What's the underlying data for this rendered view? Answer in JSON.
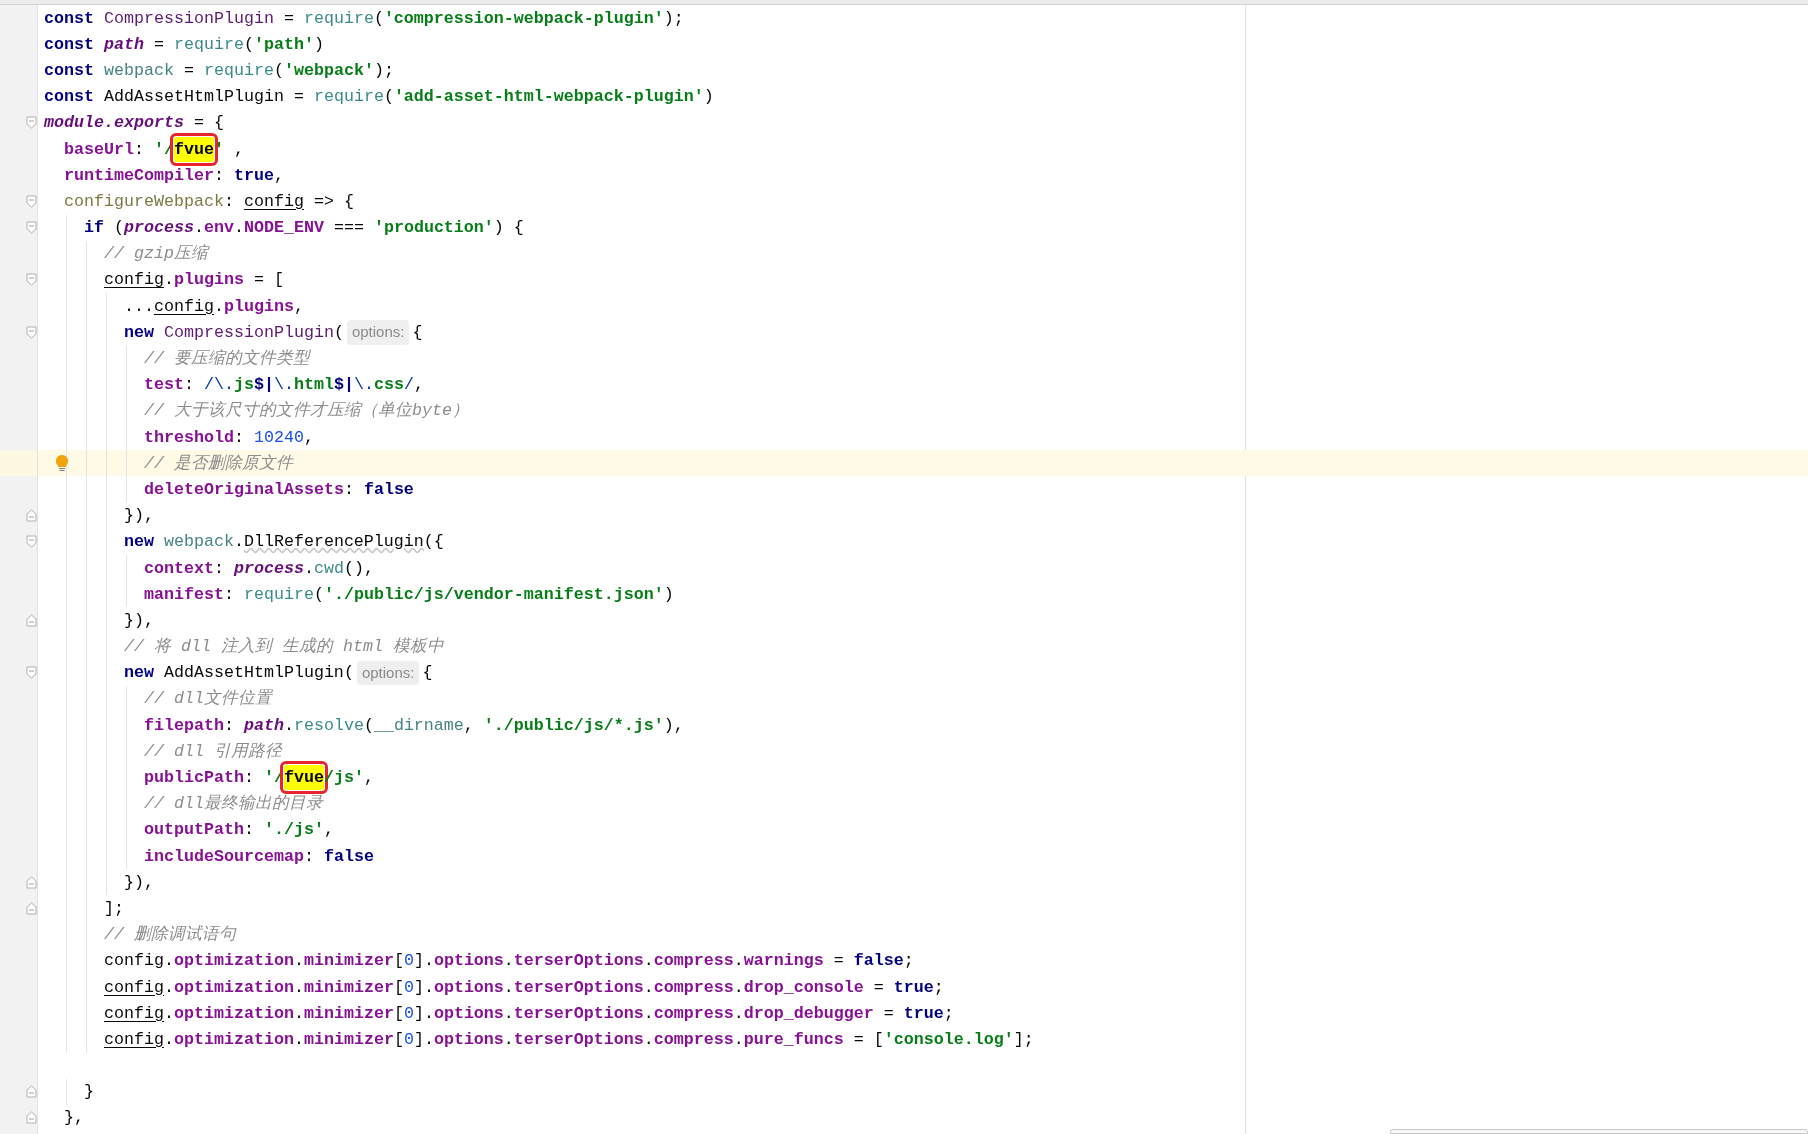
{
  "editor": {
    "lines": [
      {
        "kind": "plain",
        "current": false,
        "tokens": [
          {
            "text": "const ",
            "kind": "kw"
          },
          {
            "text": "CompressionPlugin",
            "kind": "cls"
          },
          {
            "text": " = ",
            "kind": "plain"
          },
          {
            "text": "require",
            "kind": "fn"
          },
          {
            "text": "(",
            "kind": "plain"
          },
          {
            "text": "'compression-webpack-plugin'",
            "kind": "str"
          },
          {
            "text": ");",
            "kind": "plain"
          }
        ]
      },
      {
        "kind": "plain",
        "current": false,
        "tokens": [
          {
            "text": "const ",
            "kind": "kw"
          },
          {
            "text": "path",
            "kind": "ital"
          },
          {
            "text": " = ",
            "kind": "plain"
          },
          {
            "text": "require",
            "kind": "fn"
          },
          {
            "text": "(",
            "kind": "plain"
          },
          {
            "text": "'path'",
            "kind": "str"
          },
          {
            "text": ")",
            "kind": "plain"
          }
        ]
      },
      {
        "kind": "plain",
        "current": false,
        "tokens": [
          {
            "text": "const ",
            "kind": "kw"
          },
          {
            "text": "webpack",
            "kind": "var"
          },
          {
            "text": " = ",
            "kind": "plain"
          },
          {
            "text": "require",
            "kind": "fn"
          },
          {
            "text": "(",
            "kind": "plain"
          },
          {
            "text": "'webpack'",
            "kind": "str"
          },
          {
            "text": ");",
            "kind": "plain"
          }
        ]
      },
      {
        "kind": "plain",
        "current": false,
        "tokens": [
          {
            "text": "const ",
            "kind": "kw"
          },
          {
            "text": "AddAssetHtmlPlugin",
            "kind": "plain"
          },
          {
            "text": " = ",
            "kind": "plain"
          },
          {
            "text": "require",
            "kind": "fn"
          },
          {
            "text": "(",
            "kind": "plain"
          },
          {
            "text": "'add-asset-html-webpack-plugin'",
            "kind": "str"
          },
          {
            "text": ")",
            "kind": "plain"
          }
        ]
      },
      {
        "kind": "opener",
        "current": false,
        "tokens": [
          {
            "text": "module.exports",
            "kind": "ital"
          },
          {
            "text": " = {",
            "kind": "plain"
          }
        ]
      },
      {
        "kind": "plain",
        "current": false,
        "tokens": [
          {
            "text": "  baseUrl",
            "kind": "prop"
          },
          {
            "text": ": ",
            "kind": "plain"
          },
          {
            "text": "'/",
            "kind": "str"
          },
          {
            "text": "fvue",
            "kind": "found"
          },
          {
            "text": "'",
            "kind": "str"
          },
          {
            "text": " ,",
            "kind": "plain"
          }
        ]
      },
      {
        "kind": "plain",
        "current": false,
        "tokens": [
          {
            "text": "  runtimeCompiler",
            "kind": "prop"
          },
          {
            "text": ": ",
            "kind": "plain"
          },
          {
            "text": "true",
            "kind": "kw"
          },
          {
            "text": ",",
            "kind": "plain"
          }
        ]
      },
      {
        "kind": "opener",
        "current": false,
        "tokens": [
          {
            "text": "  configureWebpack",
            "kind": "meth"
          },
          {
            "text": ": ",
            "kind": "plain"
          },
          {
            "text": "config",
            "kind": "param"
          },
          {
            "text": " => {",
            "kind": "plain"
          }
        ]
      },
      {
        "kind": "opener",
        "current": false,
        "tokens": [
          {
            "text": "    if",
            "kind": "kw"
          },
          {
            "text": " (",
            "kind": "plain"
          },
          {
            "text": "process",
            "kind": "ital"
          },
          {
            "text": ".",
            "kind": "plain"
          },
          {
            "text": "env",
            "kind": "prop"
          },
          {
            "text": ".",
            "kind": "plain"
          },
          {
            "text": "NODE_ENV",
            "kind": "prop"
          },
          {
            "text": " === ",
            "kind": "plain"
          },
          {
            "text": "'production'",
            "kind": "str"
          },
          {
            "text": ") {",
            "kind": "plain"
          }
        ]
      },
      {
        "kind": "plain",
        "current": false,
        "tokens": [
          {
            "text": "      // gzip压缩",
            "kind": "cm"
          }
        ]
      },
      {
        "kind": "opener",
        "current": false,
        "tokens": [
          {
            "text": "      config",
            "kind": "param"
          },
          {
            "text": ".",
            "kind": "plain"
          },
          {
            "text": "plugins",
            "kind": "prop"
          },
          {
            "text": " = [",
            "kind": "plain"
          }
        ]
      },
      {
        "kind": "plain",
        "current": false,
        "tokens": [
          {
            "text": "        ...",
            "kind": "plain"
          },
          {
            "text": "config",
            "kind": "param"
          },
          {
            "text": ".",
            "kind": "plain"
          },
          {
            "text": "plugins",
            "kind": "prop"
          },
          {
            "text": ",",
            "kind": "plain"
          }
        ]
      },
      {
        "kind": "opener",
        "current": false,
        "tokens": [
          {
            "text": "        new ",
            "kind": "kw"
          },
          {
            "text": "CompressionPlugin",
            "kind": "cls"
          },
          {
            "text": "(",
            "kind": "plain"
          },
          {
            "text": "options:",
            "kind": "hint"
          },
          {
            "text": "{",
            "kind": "plain"
          }
        ]
      },
      {
        "kind": "plain",
        "current": false,
        "tokens": [
          {
            "text": "          // 要压缩的文件类型",
            "kind": "cm"
          }
        ]
      },
      {
        "kind": "plain",
        "current": false,
        "tokens": [
          {
            "text": "          test",
            "kind": "prop"
          },
          {
            "text": ": ",
            "kind": "plain"
          },
          {
            "text": "/\\.",
            "kind": "rx"
          },
          {
            "text": "js",
            "kind": "str"
          },
          {
            "text": "$|",
            "kind": "kw"
          },
          {
            "text": "\\.",
            "kind": "rx"
          },
          {
            "text": "html",
            "kind": "str"
          },
          {
            "text": "$|",
            "kind": "kw"
          },
          {
            "text": "\\.",
            "kind": "rx"
          },
          {
            "text": "css",
            "kind": "str"
          },
          {
            "text": "/",
            "kind": "rx"
          },
          {
            "text": ",",
            "kind": "plain"
          }
        ]
      },
      {
        "kind": "plain",
        "current": false,
        "tokens": [
          {
            "text": "          // 大于该尺寸的文件才压缩（单位byte）",
            "kind": "cm"
          }
        ]
      },
      {
        "kind": "plain",
        "current": false,
        "tokens": [
          {
            "text": "          threshold",
            "kind": "prop"
          },
          {
            "text": ": ",
            "kind": "plain"
          },
          {
            "text": "10240",
            "kind": "num"
          },
          {
            "text": ",",
            "kind": "plain"
          }
        ]
      },
      {
        "kind": "plain",
        "current": true,
        "tokens": [
          {
            "text": "          // 是否删除原文件",
            "kind": "cm"
          }
        ]
      },
      {
        "kind": "plain",
        "current": false,
        "tokens": [
          {
            "text": "          deleteOriginalAssets",
            "kind": "prop"
          },
          {
            "text": ": ",
            "kind": "plain"
          },
          {
            "text": "false",
            "kind": "kw"
          }
        ]
      },
      {
        "kind": "closer",
        "current": false,
        "tokens": [
          {
            "text": "        }),",
            "kind": "plain"
          }
        ]
      },
      {
        "kind": "opener",
        "current": false,
        "tokens": [
          {
            "text": "        new ",
            "kind": "kw"
          },
          {
            "text": "webpack",
            "kind": "var"
          },
          {
            "text": ".",
            "kind": "plain"
          },
          {
            "text": "DllReferencePlugin",
            "kind": "warn"
          },
          {
            "text": "({",
            "kind": "plain"
          }
        ]
      },
      {
        "kind": "plain",
        "current": false,
        "tokens": [
          {
            "text": "          context",
            "kind": "prop"
          },
          {
            "text": ": ",
            "kind": "plain"
          },
          {
            "text": "process",
            "kind": "ital"
          },
          {
            "text": ".",
            "kind": "plain"
          },
          {
            "text": "cwd",
            "kind": "fn"
          },
          {
            "text": "(),",
            "kind": "plain"
          }
        ]
      },
      {
        "kind": "plain",
        "current": false,
        "tokens": [
          {
            "text": "          manifest",
            "kind": "prop"
          },
          {
            "text": ": ",
            "kind": "plain"
          },
          {
            "text": "require",
            "kind": "fn"
          },
          {
            "text": "(",
            "kind": "plain"
          },
          {
            "text": "'./public/js/vendor-manifest.json'",
            "kind": "str"
          },
          {
            "text": ")",
            "kind": "plain"
          }
        ]
      },
      {
        "kind": "closer",
        "current": false,
        "tokens": [
          {
            "text": "        }),",
            "kind": "plain"
          }
        ]
      },
      {
        "kind": "plain",
        "current": false,
        "tokens": [
          {
            "text": "        // 将 dll 注入到 生成的 html 模板中",
            "kind": "cm"
          }
        ]
      },
      {
        "kind": "opener",
        "current": false,
        "tokens": [
          {
            "text": "        new ",
            "kind": "kw"
          },
          {
            "text": "AddAssetHtmlPlugin",
            "kind": "plain"
          },
          {
            "text": "(",
            "kind": "plain"
          },
          {
            "text": "options:",
            "kind": "hint"
          },
          {
            "text": "{",
            "kind": "plain"
          }
        ]
      },
      {
        "kind": "plain",
        "current": false,
        "tokens": [
          {
            "text": "          // dll文件位置",
            "kind": "cm"
          }
        ]
      },
      {
        "kind": "plain",
        "current": false,
        "tokens": [
          {
            "text": "          filepath",
            "kind": "prop"
          },
          {
            "text": ": ",
            "kind": "plain"
          },
          {
            "text": "path",
            "kind": "ital"
          },
          {
            "text": ".",
            "kind": "plain"
          },
          {
            "text": "resolve",
            "kind": "fn"
          },
          {
            "text": "(",
            "kind": "plain"
          },
          {
            "text": "__dirname",
            "kind": "var"
          },
          {
            "text": ", ",
            "kind": "plain"
          },
          {
            "text": "'./public/js/*.js'",
            "kind": "str"
          },
          {
            "text": "),",
            "kind": "plain"
          }
        ]
      },
      {
        "kind": "plain",
        "current": false,
        "tokens": [
          {
            "text": "          // dll 引用路径",
            "kind": "cm"
          }
        ]
      },
      {
        "kind": "plain",
        "current": false,
        "tokens": [
          {
            "text": "          publicPath",
            "kind": "prop"
          },
          {
            "text": ": ",
            "kind": "plain"
          },
          {
            "text": "'/",
            "kind": "str"
          },
          {
            "text": "fvue",
            "kind": "found"
          },
          {
            "text": "/js'",
            "kind": "str"
          },
          {
            "text": ",",
            "kind": "plain"
          }
        ]
      },
      {
        "kind": "plain",
        "current": false,
        "tokens": [
          {
            "text": "          // dll最终输出的目录",
            "kind": "cm"
          }
        ]
      },
      {
        "kind": "plain",
        "current": false,
        "tokens": [
          {
            "text": "          outputPath",
            "kind": "prop"
          },
          {
            "text": ": ",
            "kind": "plain"
          },
          {
            "text": "'./js'",
            "kind": "str"
          },
          {
            "text": ",",
            "kind": "plain"
          }
        ]
      },
      {
        "kind": "plain",
        "current": false,
        "tokens": [
          {
            "text": "          includeSourcemap",
            "kind": "prop"
          },
          {
            "text": ": ",
            "kind": "plain"
          },
          {
            "text": "false",
            "kind": "kw"
          }
        ]
      },
      {
        "kind": "closer",
        "current": false,
        "tokens": [
          {
            "text": "        }),",
            "kind": "plain"
          }
        ]
      },
      {
        "kind": "closer",
        "current": false,
        "tokens": [
          {
            "text": "      ];",
            "kind": "plain"
          }
        ]
      },
      {
        "kind": "plain",
        "current": false,
        "tokens": [
          {
            "text": "      // 删除调试语句",
            "kind": "cm"
          }
        ]
      },
      {
        "kind": "plain",
        "current": false,
        "tokens": [
          {
            "text": "      config",
            "kind": "plain"
          },
          {
            "text": ".",
            "kind": "plain"
          },
          {
            "text": "optimization",
            "kind": "prop"
          },
          {
            "text": ".",
            "kind": "plain"
          },
          {
            "text": "minimizer",
            "kind": "prop"
          },
          {
            "text": "[",
            "kind": "plain"
          },
          {
            "text": "0",
            "kind": "num"
          },
          {
            "text": "].",
            "kind": "plain"
          },
          {
            "text": "options",
            "kind": "prop"
          },
          {
            "text": ".",
            "kind": "plain"
          },
          {
            "text": "terserOptions",
            "kind": "prop"
          },
          {
            "text": ".",
            "kind": "plain"
          },
          {
            "text": "compress",
            "kind": "prop"
          },
          {
            "text": ".",
            "kind": "plain"
          },
          {
            "text": "warnings",
            "kind": "prop"
          },
          {
            "text": " = ",
            "kind": "plain"
          },
          {
            "text": "false",
            "kind": "kw"
          },
          {
            "text": ";",
            "kind": "plain"
          }
        ]
      },
      {
        "kind": "plain",
        "current": false,
        "tokens": [
          {
            "text": "      config",
            "kind": "param"
          },
          {
            "text": ".",
            "kind": "plain"
          },
          {
            "text": "optimization",
            "kind": "prop"
          },
          {
            "text": ".",
            "kind": "plain"
          },
          {
            "text": "minimizer",
            "kind": "prop"
          },
          {
            "text": "[",
            "kind": "plain"
          },
          {
            "text": "0",
            "kind": "num"
          },
          {
            "text": "].",
            "kind": "plain"
          },
          {
            "text": "options",
            "kind": "prop"
          },
          {
            "text": ".",
            "kind": "plain"
          },
          {
            "text": "terserOptions",
            "kind": "prop"
          },
          {
            "text": ".",
            "kind": "plain"
          },
          {
            "text": "compress",
            "kind": "prop"
          },
          {
            "text": ".",
            "kind": "plain"
          },
          {
            "text": "drop_console",
            "kind": "prop"
          },
          {
            "text": " = ",
            "kind": "plain"
          },
          {
            "text": "true",
            "kind": "kw"
          },
          {
            "text": ";",
            "kind": "plain"
          }
        ]
      },
      {
        "kind": "plain",
        "current": false,
        "tokens": [
          {
            "text": "      config",
            "kind": "param"
          },
          {
            "text": ".",
            "kind": "plain"
          },
          {
            "text": "optimization",
            "kind": "prop"
          },
          {
            "text": ".",
            "kind": "plain"
          },
          {
            "text": "minimizer",
            "kind": "prop"
          },
          {
            "text": "[",
            "kind": "plain"
          },
          {
            "text": "0",
            "kind": "num"
          },
          {
            "text": "].",
            "kind": "plain"
          },
          {
            "text": "options",
            "kind": "prop"
          },
          {
            "text": ".",
            "kind": "plain"
          },
          {
            "text": "terserOptions",
            "kind": "prop"
          },
          {
            "text": ".",
            "kind": "plain"
          },
          {
            "text": "compress",
            "kind": "prop"
          },
          {
            "text": ".",
            "kind": "plain"
          },
          {
            "text": "drop_debugger",
            "kind": "prop"
          },
          {
            "text": " = ",
            "kind": "plain"
          },
          {
            "text": "true",
            "kind": "kw"
          },
          {
            "text": ";",
            "kind": "plain"
          }
        ]
      },
      {
        "kind": "plain",
        "current": false,
        "tokens": [
          {
            "text": "      config",
            "kind": "param"
          },
          {
            "text": ".",
            "kind": "plain"
          },
          {
            "text": "optimization",
            "kind": "prop"
          },
          {
            "text": ".",
            "kind": "plain"
          },
          {
            "text": "minimizer",
            "kind": "prop"
          },
          {
            "text": "[",
            "kind": "plain"
          },
          {
            "text": "0",
            "kind": "num"
          },
          {
            "text": "].",
            "kind": "plain"
          },
          {
            "text": "options",
            "kind": "prop"
          },
          {
            "text": ".",
            "kind": "plain"
          },
          {
            "text": "terserOptions",
            "kind": "prop"
          },
          {
            "text": ".",
            "kind": "plain"
          },
          {
            "text": "compress",
            "kind": "prop"
          },
          {
            "text": ".",
            "kind": "plain"
          },
          {
            "text": "pure_funcs",
            "kind": "prop"
          },
          {
            "text": " = [",
            "kind": "plain"
          },
          {
            "text": "'console.log'",
            "kind": "str"
          },
          {
            "text": "];",
            "kind": "plain"
          }
        ]
      },
      {
        "kind": "plain",
        "current": false
      },
      {
        "kind": "closer",
        "current": false,
        "tokens": [
          {
            "text": "    }",
            "kind": "plain"
          }
        ]
      },
      {
        "kind": "closer",
        "current": false,
        "tokens": [
          {
            "text": "  },",
            "kind": "plain"
          }
        ]
      }
    ]
  }
}
